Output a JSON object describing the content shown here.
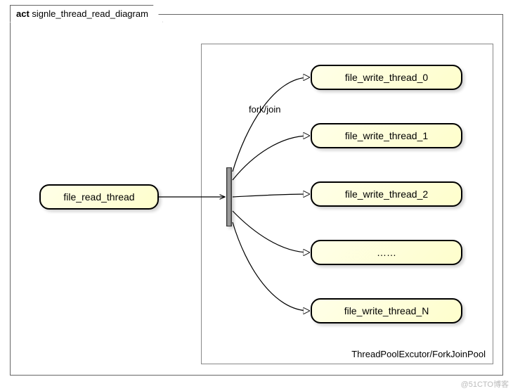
{
  "diagram": {
    "title_prefix": "act",
    "title": "signle_thread_read_diagram",
    "pool_label": "ThreadPoolExcutor/ForkJoinPool",
    "edge_label": "fork/join",
    "nodes": {
      "read": "file_read_thread",
      "w0": "file_write_thread_0",
      "w1": "file_write_thread_1",
      "w2": "file_write_thread_2",
      "dots": "……",
      "wn": "file_write_thread_N"
    }
  },
  "watermark": "@51CTO博客"
}
